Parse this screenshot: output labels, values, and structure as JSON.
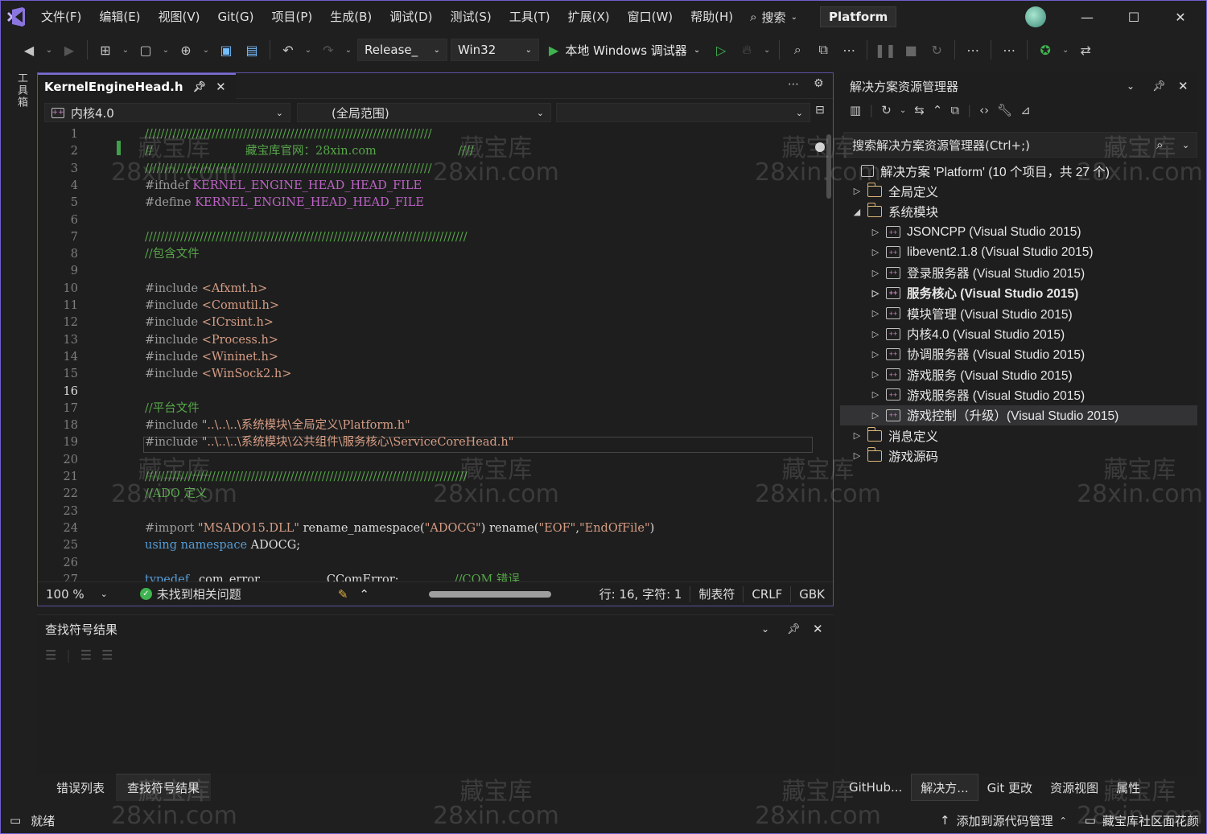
{
  "menu": [
    "文件(F)",
    "编辑(E)",
    "视图(V)",
    "Git(G)",
    "项目(P)",
    "生成(B)",
    "调试(D)",
    "测试(S)",
    "工具(T)",
    "扩展(X)",
    "窗口(W)",
    "帮助(H)"
  ],
  "search_label": "搜索",
  "solution_name": "Platform",
  "toolbar": {
    "config": "Release_",
    "platform": "Win32",
    "debugger": "本地 Windows 调试器"
  },
  "toolbox_label": "工具箱",
  "editor": {
    "tab_title": "KernelEngineHead.h",
    "project_combo": "内核4.0",
    "scope_combo": "(全局范围)",
    "member_combo": "",
    "lines": [
      {
        "n": "1",
        "parts": [
          {
            "c": "c-comment",
            "t": "/////////////////////////////////////////////////////////////////////////"
          }
        ]
      },
      {
        "n": "2",
        "parts": [
          {
            "c": "c-comment",
            "t": "//                         藏宝库官网：28xin.com                      ////"
          }
        ]
      },
      {
        "n": "3",
        "parts": [
          {
            "c": "c-comment",
            "t": "/////////////////////////////////////////////////////////////////////////"
          }
        ]
      },
      {
        "n": "4",
        "parts": [
          {
            "c": "c-pre",
            "t": "#ifndef "
          },
          {
            "c": "c-macro",
            "t": "KERNEL_ENGINE_HEAD_HEAD_FILE"
          }
        ]
      },
      {
        "n": "5",
        "parts": [
          {
            "c": "c-pre",
            "t": "#define "
          },
          {
            "c": "c-macro",
            "t": "KERNEL_ENGINE_HEAD_HEAD_FILE"
          }
        ]
      },
      {
        "n": "6",
        "parts": []
      },
      {
        "n": "7",
        "parts": [
          {
            "c": "c-comment",
            "t": "//////////////////////////////////////////////////////////////////////////////////"
          }
        ]
      },
      {
        "n": "8",
        "parts": [
          {
            "c": "c-comment",
            "t": "//包含文件"
          }
        ]
      },
      {
        "n": "9",
        "parts": []
      },
      {
        "n": "10",
        "parts": [
          {
            "c": "c-pre",
            "t": "#include "
          },
          {
            "c": "c-string",
            "t": "<Afxmt.h>"
          }
        ]
      },
      {
        "n": "11",
        "parts": [
          {
            "c": "c-pre",
            "t": "#include "
          },
          {
            "c": "c-string",
            "t": "<Comutil.h>"
          }
        ]
      },
      {
        "n": "12",
        "parts": [
          {
            "c": "c-pre",
            "t": "#include "
          },
          {
            "c": "c-string",
            "t": "<ICrsint.h>"
          }
        ]
      },
      {
        "n": "13",
        "parts": [
          {
            "c": "c-pre",
            "t": "#include "
          },
          {
            "c": "c-string",
            "t": "<Process.h>"
          }
        ]
      },
      {
        "n": "14",
        "parts": [
          {
            "c": "c-pre",
            "t": "#include "
          },
          {
            "c": "c-string",
            "t": "<Wininet.h>"
          }
        ]
      },
      {
        "n": "15",
        "parts": [
          {
            "c": "c-pre",
            "t": "#include "
          },
          {
            "c": "c-string",
            "t": "<WinSock2.h>"
          }
        ]
      },
      {
        "n": "16",
        "parts": []
      },
      {
        "n": "17",
        "parts": [
          {
            "c": "c-comment",
            "t": "//平台文件"
          }
        ]
      },
      {
        "n": "18",
        "parts": [
          {
            "c": "c-pre",
            "t": "#include "
          },
          {
            "c": "c-string",
            "t": "\"..\\..\\..\\系统模块\\全局定义\\Platform.h\""
          }
        ]
      },
      {
        "n": "19",
        "parts": [
          {
            "c": "c-pre",
            "t": "#include "
          },
          {
            "c": "c-string",
            "t": "\"..\\..\\..\\系统模块\\公共组件\\服务核心\\ServiceCoreHead.h\""
          }
        ]
      },
      {
        "n": "20",
        "parts": []
      },
      {
        "n": "21",
        "parts": [
          {
            "c": "c-comment",
            "t": "//////////////////////////////////////////////////////////////////////////////////"
          }
        ]
      },
      {
        "n": "22",
        "parts": [
          {
            "c": "c-comment",
            "t": "//ADO 定义"
          }
        ]
      },
      {
        "n": "23",
        "parts": []
      },
      {
        "n": "24",
        "parts": [
          {
            "c": "c-pre",
            "t": "#import "
          },
          {
            "c": "c-string",
            "t": "\"MSADO15.DLL\""
          },
          {
            "c": "c-plain",
            "t": " rename_namespace("
          },
          {
            "c": "c-string",
            "t": "\"ADOCG\""
          },
          {
            "c": "c-plain",
            "t": ") rename("
          },
          {
            "c": "c-string",
            "t": "\"EOF\""
          },
          {
            "c": "c-plain",
            "t": ","
          },
          {
            "c": "c-string",
            "t": "\"EndOfFile\""
          },
          {
            "c": "c-plain",
            "t": ")"
          }
        ]
      },
      {
        "n": "25",
        "parts": [
          {
            "c": "c-kw",
            "t": "using namespace"
          },
          {
            "c": "c-plain",
            "t": " ADOCG;"
          }
        ]
      },
      {
        "n": "26",
        "parts": []
      },
      {
        "n": "27",
        "parts": [
          {
            "c": "c-kw",
            "t": "typedef"
          },
          {
            "c": "c-plain",
            "t": " _com_error                  CComError;               "
          },
          {
            "c": "c-comment",
            "t": "//COM 错误"
          }
        ]
      }
    ],
    "current_line": "16",
    "status": {
      "zoom": "100 %",
      "issues": "未找到相关问题",
      "position": "行: 16, 字符: 1",
      "indent": "制表符",
      "eol": "CRLF",
      "encoding": "GBK"
    }
  },
  "find_panel": {
    "title": "查找符号结果"
  },
  "bottom_tabs": [
    "错误列表",
    "查找符号结果"
  ],
  "solution_explorer": {
    "title": "解决方案资源管理器",
    "search_placeholder": "搜索解决方案资源管理器(Ctrl+;)",
    "root": "解决方案 'Platform' (10 个项目，共 27 个)",
    "items": [
      {
        "label": "全局定义",
        "type": "folder",
        "level": 1,
        "expanded": false
      },
      {
        "label": "系统模块",
        "type": "folder",
        "level": 1,
        "expanded": true
      },
      {
        "label": "JSONCPP (Visual Studio 2015)",
        "type": "project",
        "level": 2
      },
      {
        "label": "libevent2.1.8 (Visual Studio 2015)",
        "type": "project",
        "level": 2
      },
      {
        "label": "登录服务器 (Visual Studio 2015)",
        "type": "project",
        "level": 2
      },
      {
        "label": "服务核心 (Visual Studio 2015)",
        "type": "project",
        "level": 2,
        "bold": true
      },
      {
        "label": "模块管理 (Visual Studio 2015)",
        "type": "project",
        "level": 2
      },
      {
        "label": "内核4.0 (Visual Studio 2015)",
        "type": "project",
        "level": 2
      },
      {
        "label": "协调服务器 (Visual Studio 2015)",
        "type": "project",
        "level": 2
      },
      {
        "label": "游戏服务 (Visual Studio 2015)",
        "type": "project",
        "level": 2
      },
      {
        "label": "游戏服务器 (Visual Studio 2015)",
        "type": "project",
        "level": 2
      },
      {
        "label": "游戏控制（升级）(Visual Studio 2015)",
        "type": "project",
        "level": 2,
        "selected": true
      },
      {
        "label": "消息定义",
        "type": "folder",
        "level": 1,
        "expanded": false
      },
      {
        "label": "游戏源码",
        "type": "folder",
        "level": 1,
        "expanded": false
      }
    ]
  },
  "right_tabs": [
    "GitHub...",
    "解决方...",
    "Git 更改",
    "资源视图",
    "属性"
  ],
  "statusbar": {
    "ready": "就绪",
    "source_control": "添加到源代码管理",
    "repo": "藏宝库社区面花颜"
  },
  "watermark": {
    "line1": "藏宝库",
    "line2": "28xin.com"
  },
  "colors": {
    "accent": "#7a6fd0",
    "background": "#1f1f1f",
    "editor_bg": "#1e1e1e",
    "comment": "#57a64a",
    "string": "#d69d85",
    "keyword": "#569cd6",
    "macro": "#bd63c5"
  }
}
